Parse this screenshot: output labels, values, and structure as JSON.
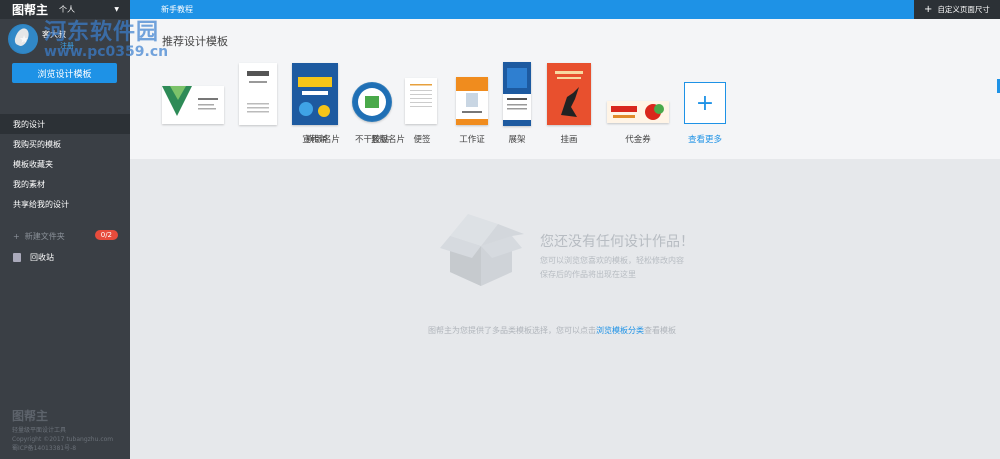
{
  "sidebar": {
    "logo": "图帮主",
    "workspace": "个人",
    "username": "客大叔",
    "register": "注册",
    "browse_button": "浏览设计模板",
    "nav": [
      {
        "label": "我的设计"
      },
      {
        "label": "我购买的模板"
      },
      {
        "label": "模板收藏夹"
      },
      {
        "label": "我的素材"
      },
      {
        "label": "共享给我的设计"
      }
    ],
    "new_folder": "新建文件夹",
    "folder_count": "0/2",
    "recycle": "回收站",
    "footer": {
      "logo": "图帮主",
      "slogan": "轻量级平面设计工具",
      "copyright": "Copyright ©2017 tubangzhu.com",
      "icp": "蜀ICP备14013381号-8"
    }
  },
  "topbar": {
    "tutorial": "新手教程",
    "custom_size": "自定义页面尺寸"
  },
  "templates": {
    "title": "推荐设计模板",
    "items": [
      {
        "label": "横版名片"
      },
      {
        "label": "竖版名片"
      },
      {
        "label": "宣传单"
      },
      {
        "label": "不干胶贴"
      },
      {
        "label": "便签"
      },
      {
        "label": "工作证"
      },
      {
        "label": "展架"
      },
      {
        "label": "挂画"
      },
      {
        "label": "代金券"
      }
    ],
    "more_label": "查看更多"
  },
  "empty_state": {
    "title": "您还没有任何设计作品！",
    "line1": "您可以浏览您喜欢的模板，轻松修改内容",
    "line2": "保存后的作品将出现在这里",
    "hint_prefix": "图帮主为您提供了多品类模板选择，您可以点击",
    "hint_link": "浏览模板分类",
    "hint_suffix": "查看模板"
  },
  "watermark": {
    "title": "河东软件园",
    "url": "www.pc0359.cn"
  },
  "colors": {
    "accent": "#1e92e6",
    "sidebar_bg": "#3a3f45",
    "badge": "#e74c3c"
  }
}
